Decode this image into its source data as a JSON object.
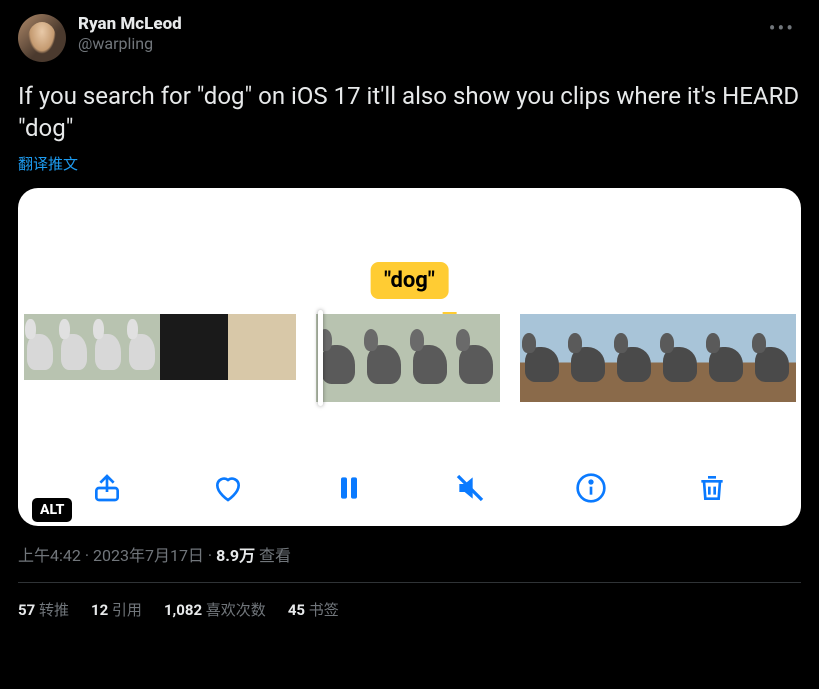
{
  "author": {
    "display_name": "Ryan McLeod",
    "handle": "@warpling"
  },
  "body_text": "If you search for \"dog\" on iOS 17 it'll also show you clips where it's HEARD \"dog\"",
  "translate_label": "翻译推文",
  "media": {
    "search_term_label": "\"dog\"",
    "alt_badge": "ALT"
  },
  "meta": {
    "time": "上午4:42",
    "date": "2023年7月17日",
    "views_count": "8.9万",
    "views_label": "查看"
  },
  "stats": {
    "retweets_count": "57",
    "retweets_label": "转推",
    "quotes_count": "12",
    "quotes_label": "引用",
    "likes_count": "1,082",
    "likes_label": "喜欢次数",
    "bookmarks_count": "45",
    "bookmarks_label": "书签"
  }
}
